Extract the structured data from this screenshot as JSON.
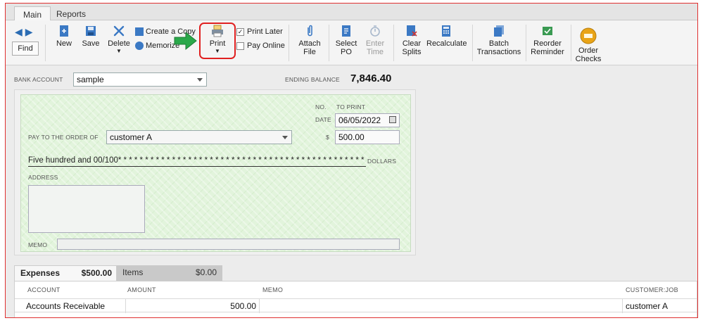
{
  "tabs": [
    "Main",
    "Reports"
  ],
  "toolbar": {
    "find": "Find",
    "new": "New",
    "save": "Save",
    "delete": "Delete",
    "create_copy": "Create a Copy",
    "memorize": "Memorize",
    "print": "Print",
    "print_later": "Print Later",
    "pay_online": "Pay Online",
    "attach_file": [
      "Attach",
      "File"
    ],
    "select_po": [
      "Select",
      "PO"
    ],
    "enter_time": [
      "Enter",
      "Time"
    ],
    "clear_splits": [
      "Clear",
      "Splits"
    ],
    "recalculate": "Recalculate",
    "batch_transactions": [
      "Batch",
      "Transactions"
    ],
    "reorder_reminder": [
      "Reorder",
      "Reminder"
    ],
    "order_checks": [
      "Order",
      "Checks"
    ],
    "print_later_checked": true,
    "pay_online_checked": false
  },
  "bank": {
    "label": "BANK ACCOUNT",
    "value": "sample",
    "ending_balance_label": "ENDING BALANCE",
    "ending_balance": "7,846.40"
  },
  "check": {
    "no_label": "NO.",
    "no_value": "TO PRINT",
    "date_label": "DATE",
    "date": "06/05/2022",
    "pay_to_label": "PAY TO THE ORDER OF",
    "payee": "customer A",
    "amount_symbol": "$",
    "amount": "500.00",
    "written_amount": "Five hundred and 00/100* * * * * * * * * * * * * * * * * * * * * * * * * * * * * * * * * * * * * * * * * * * * * * * * *",
    "dollars_label": "DOLLARS",
    "address_label": "ADDRESS",
    "memo_label": "MEMO"
  },
  "split_tabs": [
    {
      "label": "Expenses",
      "amount": "$500.00"
    },
    {
      "label": "Items",
      "amount": "$0.00"
    }
  ],
  "grid": {
    "headers": [
      "ACCOUNT",
      "AMOUNT",
      "MEMO",
      "CUSTOMER:JOB"
    ],
    "rows": [
      {
        "account": "Accounts Receivable",
        "amount": "500.00",
        "memo": "",
        "customer_job": "customer A"
      }
    ]
  },
  "colors": {
    "highlight": "#e02020",
    "check_bg": "#e2f4dc",
    "accent_blue": "#2b6cb3",
    "arrow_green": "#2aa84a"
  }
}
